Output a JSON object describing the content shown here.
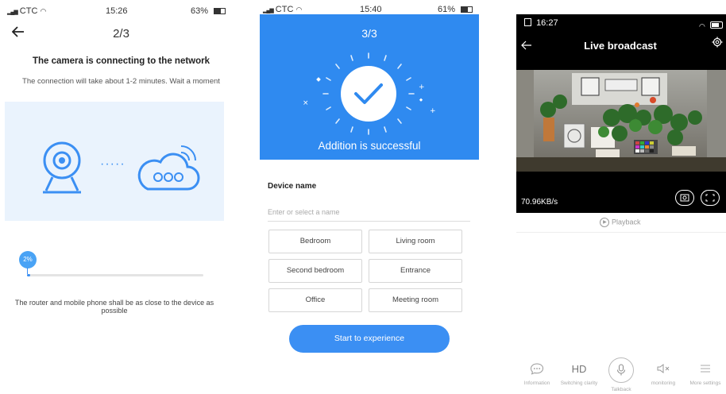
{
  "panel1": {
    "status": {
      "carrier": "CTC",
      "time": "15:26",
      "battery": "63%"
    },
    "step": "2/3",
    "heading": "The camera is connecting to the network",
    "subheading": "The connection will take about 1-2 minutes. Wait a moment",
    "progress": {
      "label": "2%",
      "value": 0.02
    },
    "note": "The router and mobile phone shall be as close to the device as possible",
    "dots": "·····"
  },
  "panel2": {
    "status": {
      "carrier": "CTC",
      "time": "15:40",
      "battery": "61%"
    },
    "step": "3/3",
    "success": "Addition is successful",
    "device_name_label": "Device name",
    "device_name_placeholder": "Enter or select a name",
    "rooms": [
      "Bedroom",
      "Living room",
      "Second bedroom",
      "Entrance",
      "Office",
      "Meeting room"
    ],
    "start_button": "Start to experience",
    "accent": "#2f8af0"
  },
  "panel3": {
    "status": {
      "time": "16:27"
    },
    "title": "Live broadcast",
    "speed": "70.96KB/s",
    "playback": "Playback",
    "bottom": [
      {
        "icon": "chat-icon",
        "label": "Information"
      },
      {
        "icon": "hd-icon",
        "glyph": "HD",
        "label": "Switching clarity"
      },
      {
        "icon": "microphone-icon",
        "label": "Talkback"
      },
      {
        "icon": "speaker-mute-icon",
        "label": "monitoring"
      },
      {
        "icon": "menu-icon",
        "label": "More settings"
      }
    ]
  }
}
